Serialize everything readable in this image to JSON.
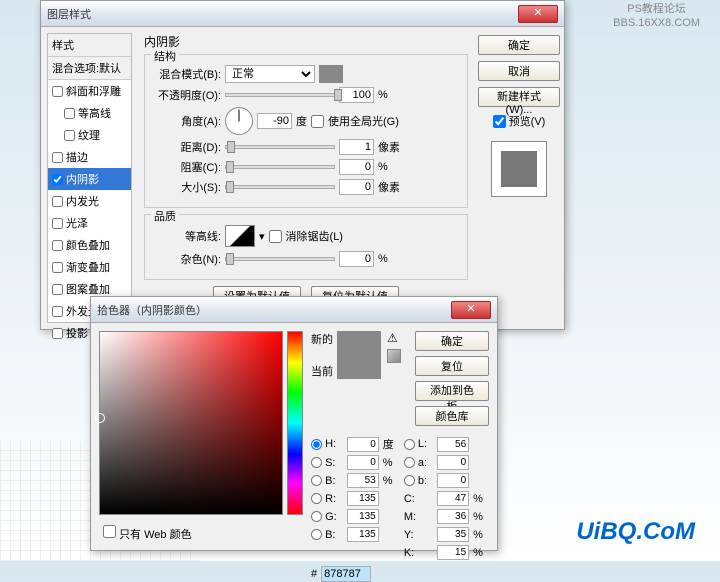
{
  "watermark": {
    "line1": "PS教程论坛",
    "line2": "BBS.16XX8.COM"
  },
  "logo": "UiBQ.CoM",
  "dialog1": {
    "title": "图层样式",
    "styles_header": "样式",
    "blend_default": "混合选项:默认",
    "items": [
      {
        "label": "斜面和浮雕",
        "checked": false
      },
      {
        "label": "等高线",
        "checked": false
      },
      {
        "label": "纹理",
        "checked": false
      },
      {
        "label": "描边",
        "checked": false
      },
      {
        "label": "内阴影",
        "checked": true,
        "selected": true
      },
      {
        "label": "内发光",
        "checked": false
      },
      {
        "label": "光泽",
        "checked": false
      },
      {
        "label": "颜色叠加",
        "checked": false
      },
      {
        "label": "渐变叠加",
        "checked": false
      },
      {
        "label": "图案叠加",
        "checked": false
      },
      {
        "label": "外发光",
        "checked": false
      },
      {
        "label": "投影",
        "checked": false
      }
    ],
    "section_title": "内阴影",
    "group_structure": "结构",
    "group_quality": "品质",
    "blend_mode_label": "混合模式(B):",
    "blend_mode_value": "正常",
    "opacity_label": "不透明度(O):",
    "opacity_value": "100",
    "pct": "%",
    "angle_label": "角度(A):",
    "angle_value": "-90",
    "deg": "度",
    "global_light": "使用全局光(G)",
    "distance_label": "距离(D):",
    "distance_value": "1",
    "px": "像素",
    "choke_label": "阻塞(C):",
    "choke_value": "0",
    "size_label": "大小(S):",
    "size_value": "0",
    "contour_label": "等高线:",
    "antialias": "消除锯齿(L)",
    "noise_label": "杂色(N):",
    "noise_value": "0",
    "set_default": "设置为默认值",
    "reset_default": "复位为默认值",
    "ok": "确定",
    "cancel": "取消",
    "new_style": "新建样式(W)...",
    "preview": "预览(V)"
  },
  "dialog2": {
    "title": "拾色器（内阴影颜色）",
    "new": "新的",
    "current": "当前",
    "ok": "确定",
    "reset": "复位",
    "add_swatch": "添加到色板",
    "color_lib": "颜色库",
    "web_only": "只有 Web 颜色",
    "hex_label": "#",
    "hex_value": "878787",
    "H": {
      "l": "H:",
      "v": "0",
      "u": "度"
    },
    "S": {
      "l": "S:",
      "v": "0",
      "u": "%"
    },
    "Bv": {
      "l": "B:",
      "v": "53",
      "u": "%"
    },
    "L": {
      "l": "L:",
      "v": "56",
      "u": ""
    },
    "a": {
      "l": "a:",
      "v": "0",
      "u": ""
    },
    "b": {
      "l": "b:",
      "v": "0",
      "u": ""
    },
    "R": {
      "l": "R:",
      "v": "135",
      "u": ""
    },
    "G": {
      "l": "G:",
      "v": "135",
      "u": ""
    },
    "Bb": {
      "l": "B:",
      "v": "135",
      "u": ""
    },
    "C": {
      "l": "C:",
      "v": "47",
      "u": "%"
    },
    "M": {
      "l": "M:",
      "v": "36",
      "u": "%"
    },
    "Y": {
      "l": "Y:",
      "v": "35",
      "u": "%"
    },
    "K": {
      "l": "K:",
      "v": "15",
      "u": "%"
    }
  }
}
